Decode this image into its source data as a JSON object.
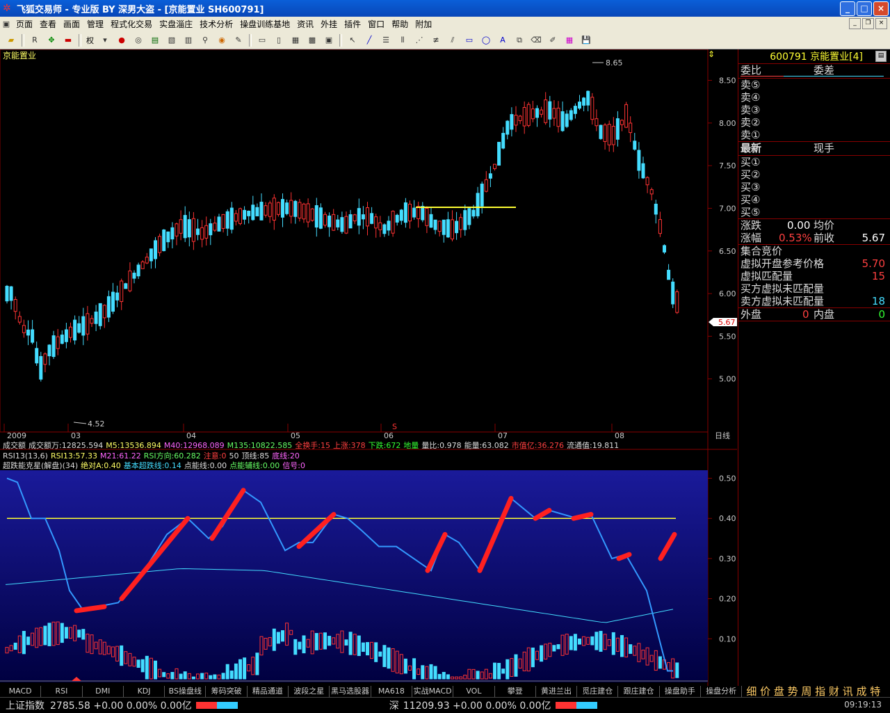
{
  "window": {
    "title": "飞狐交易师 - 专业版 BY 深男大盗 - [京能置业 SH600791]",
    "controls": [
      "_",
      "□",
      "×"
    ]
  },
  "menu": [
    "页面",
    "查看",
    "画面",
    "管理",
    "程式化交易",
    "实盘淄庄",
    "技术分析",
    "操盘训练基地",
    "资讯",
    "外挂",
    "插件",
    "窗口",
    "帮助",
    "附加"
  ],
  "toolbar": {
    "right_label": "权"
  },
  "main_chart": {
    "stock_name": "京能置业",
    "high_label": "8.65",
    "low_label": "4.52",
    "last_price_tag": "5.67",
    "y_ticks": [
      "8.50",
      "8.00",
      "7.50",
      "7.00",
      "6.50",
      "6.00",
      "5.50",
      "5.00"
    ],
    "x_ticks": [
      "2009",
      "03",
      "04",
      "05",
      "06",
      "07",
      "08"
    ],
    "period": "日线",
    "s_marker": "S"
  },
  "volume_line": [
    {
      "t": "成交额",
      "c": "#ddd"
    },
    {
      "t": "成交额万:12825.594",
      "c": "#ddd"
    },
    {
      "t": "M5:13536.894",
      "c": "#ffff66"
    },
    {
      "t": "M40:12968.089",
      "c": "#ff66ff"
    },
    {
      "t": "M135:10822.585",
      "c": "#66ff66"
    },
    {
      "t": "全换手:15",
      "c": "#ff4040"
    },
    {
      "t": "上涨:378",
      "c": "#ff4040"
    },
    {
      "t": "下跌:672",
      "c": "#33ff33"
    },
    {
      "t": "地量",
      "c": "#33ff33"
    },
    {
      "t": "量比:0.978",
      "c": "#ddd"
    },
    {
      "t": "能量:63.082",
      "c": "#ddd"
    },
    {
      "t": "市值亿:36.276",
      "c": "#ff4040"
    },
    {
      "t": "流通值:19.811",
      "c": "#ddd"
    }
  ],
  "rsi_line": [
    {
      "t": "RSI13(13,6)",
      "c": "#ddd"
    },
    {
      "t": "RSI13:57.33",
      "c": "#ffff66"
    },
    {
      "t": "M21:61.22",
      "c": "#ff66ff"
    },
    {
      "t": "RSI方向:60.282",
      "c": "#66ff66"
    },
    {
      "t": "注意:0",
      "c": "#ff4040"
    },
    {
      "t": "50",
      "c": "#ddd"
    },
    {
      "t": "顶线:85",
      "c": "#ddd"
    },
    {
      "t": "底线:20",
      "c": "#ff66ff"
    }
  ],
  "super_line": [
    {
      "t": "超跌能克星(解盘)(34)",
      "c": "#ddd"
    },
    {
      "t": "绝对A:0.40",
      "c": "#ffff66"
    },
    {
      "t": "基本超跌线:0.14",
      "c": "#44ddff"
    },
    {
      "t": "点能线:0.00",
      "c": "#ddd"
    },
    {
      "t": "点能辅线:0.00",
      "c": "#66ff66"
    },
    {
      "t": "信号:0",
      "c": "#ff66ff"
    }
  ],
  "lower_chart": {
    "y_ticks": [
      "0.50",
      "0.40",
      "0.30",
      "0.20",
      "0.10"
    ]
  },
  "right_panel": {
    "code": "600791",
    "name": "京能置业",
    "tab_num": "[4]",
    "weibi_label": "委比",
    "weicha_label": "委差",
    "sells": [
      "卖⑤",
      "卖④",
      "卖③",
      "卖②",
      "卖①"
    ],
    "latest_label": "最新",
    "xianshou_label": "现手",
    "buys": [
      "买①",
      "买②",
      "买③",
      "买④",
      "买⑤"
    ],
    "zhangdie_label": "涨跌",
    "zhangdie_value": "0.00",
    "junjia_label": "均价",
    "zhangfu_label": "涨幅",
    "zhangfu_value": "0.53%",
    "qianshou_label": "前收",
    "qianshou_value": "5.67",
    "auction_label": "集合竞价",
    "vopen_label": "虚拟开盘参考价格",
    "vopen_value": "5.70",
    "vmatch_label": "虚拟匹配量",
    "vmatch_value": "15",
    "vbuy_label": "买方虚拟未匹配量",
    "vbuy_value": "",
    "vsell_label": "卖方虚拟未匹配量",
    "vsell_value": "18",
    "waipan_label": "外盘",
    "waipan_value": "0",
    "neipan_label": "内盘",
    "neipan_value": "0"
  },
  "tabs": [
    "MACD",
    "RSI",
    "DMI",
    "KDJ",
    "BS操盘线",
    "筹码突破",
    "精品通道",
    "波段之星",
    "黑马选股器",
    "MA618",
    "实战MACD",
    "VOL",
    "攀登",
    "黄进兰出",
    "觅庄建仓",
    "跟庄建仓",
    "操盘助手",
    "操盘分析"
  ],
  "tabs_right_text": "细 价 盘 势 周 指 财 讯 成 特 解",
  "status": {
    "sh_label": "上证指数",
    "sh_value": "2785.58 +0.00 0.00% 0.00亿",
    "sz_label": "深",
    "sz_value": "11209.93 +0.00 0.00% 0.00亿",
    "time": "09:19:13"
  },
  "colors": {
    "up": "#ff3333",
    "down": "#44ddff",
    "accent": "#ffff33",
    "panel_border": "#880000"
  }
}
